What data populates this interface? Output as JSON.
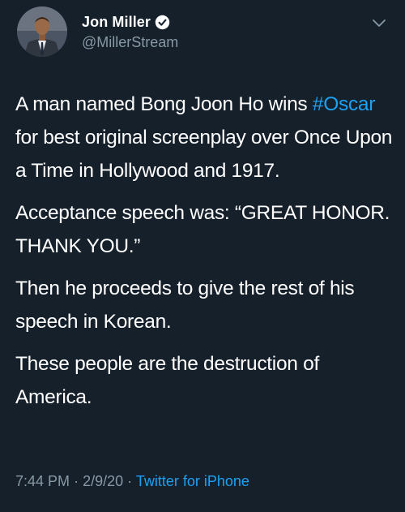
{
  "user": {
    "display_name": "Jon Miller",
    "handle": "@MillerStream",
    "verified": true
  },
  "icons": {
    "verified_badge": "verified-badge-icon",
    "menu_caret": "chevron-down-icon"
  },
  "tweet": {
    "paragraphs": [
      {
        "before": "A man named Bong Joon Ho wins ",
        "hashtag": "#Oscar",
        "after": " for best original screenplay over Once Upon a Time in Hollywood and 1917."
      },
      {
        "text": "Acceptance speech was: “GREAT HONOR. THANK YOU.”"
      },
      {
        "text": "Then he proceeds to give the rest of his speech in Korean."
      },
      {
        "text": "These people are the destruction of America."
      }
    ]
  },
  "meta": {
    "time": "7:44 PM",
    "date": "2/9/20",
    "separator": "·",
    "source": "Twitter for iPhone"
  },
  "colors": {
    "background": "#15202b",
    "text": "#ffffff",
    "secondary": "#8899a6",
    "accent": "#1da1f2"
  }
}
